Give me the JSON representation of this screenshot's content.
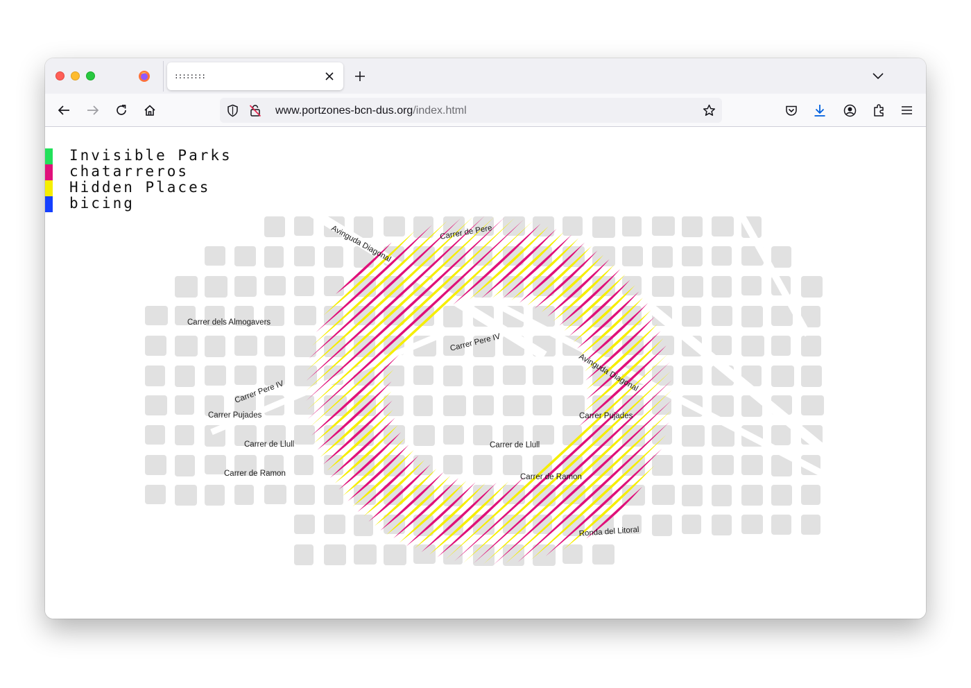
{
  "browser": {
    "tab_title": "::::::::",
    "url_domain": "www.portzones-bcn-dus.org",
    "url_path": "/index.html"
  },
  "legend": [
    {
      "label": "Invisible Parks",
      "color": "#22e05a"
    },
    {
      "label": "chatarreros",
      "color": "#e0107a"
    },
    {
      "label": "Hidden Places",
      "color": "#f5ee00"
    },
    {
      "label": "bicing",
      "color": "#1540ff"
    }
  ],
  "map": {
    "streets": {
      "almogavers": "Carrer dels Almogavers",
      "diagonal_top": "Avinguda Diagonal",
      "pere_top": "Carrer de Pere",
      "pere_center": "Carrer  Pere IV",
      "pere_left": "Carrer  Pere IV",
      "pujades_left": "Carrer  Pujades",
      "llull_left": "Carrer de Llull",
      "ramon_left": "Carrer de Ramon",
      "diagonal_right": "Avinguda  Diagonal",
      "pujades_right": "Carrer Pujades",
      "llull_center": "Carrer de Llull",
      "ramon_center": "Carrer de Ramon",
      "litoral": "Ronda del Litoral"
    },
    "colors": {
      "block": "#e1e1e1",
      "magenta": "#e0107a",
      "yellow": "#f5ee00"
    }
  }
}
